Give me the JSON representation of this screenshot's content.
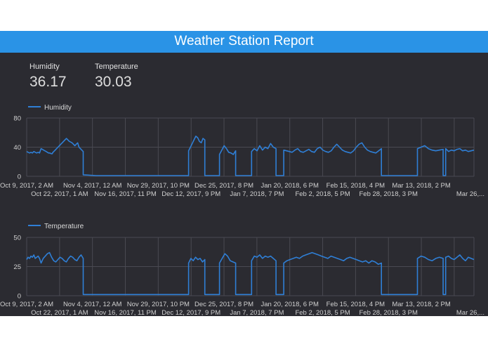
{
  "report": {
    "title": "Weather Station Report",
    "colors": {
      "header": "#2a93e6",
      "background": "#2b2b31",
      "series": "#2f7fd6",
      "grid": "#4a4a52"
    }
  },
  "scorecards": [
    {
      "label": "Humidity",
      "value": "36.17"
    },
    {
      "label": "Temperature",
      "value": "30.03"
    }
  ],
  "chart_data": [
    {
      "type": "line",
      "title": "",
      "series": [
        {
          "name": "Humidity"
        }
      ],
      "legend": "top-left",
      "ylim": [
        0,
        80
      ],
      "yticks": [
        "0",
        "40",
        "80"
      ],
      "grid": true,
      "xticks_row1": [
        "Oct 9, 2017, 2 AM",
        "Nov 4, 2017, 12 AM",
        "Nov 29, 2017, 10 PM",
        "Dec 25, 2017, 8 PM",
        "Jan 20, 2018, 6 PM",
        "Feb 15, 2018, 4 PM",
        "Mar 13, 2018, 2 PM"
      ],
      "xticks_row2": [
        "Oct 22, 2017, 1 AM",
        "Nov 16, 2017, 11 PM",
        "Dec 12, 2017, 9 PM",
        "Jan 7, 2018, 7 PM",
        "Feb 2, 2018, 5 PM",
        "Feb 28, 2018, 3 PM",
        "Mar 26,..."
      ],
      "segments": [
        {
          "x": [
            0.0,
            5.0
          ],
          "y": [
            34,
            33,
            32,
            33,
            32,
            34,
            33,
            32,
            33,
            32
          ]
        },
        {
          "x": [
            5.6,
            10.0
          ],
          "y": [
            38,
            37,
            36,
            35,
            34,
            33,
            32,
            32,
            31,
            31
          ]
        },
        {
          "x": [
            10.0,
            22.0
          ],
          "y": [
            32,
            34,
            36,
            38,
            40,
            42,
            44,
            46,
            48,
            50,
            52,
            50,
            48,
            47,
            46,
            44,
            42,
            44,
            46,
            40,
            38,
            36,
            34
          ]
        },
        {
          "x": [
            22.0,
            63.0
          ],
          "y": [
            2,
            1,
            1,
            1,
            1,
            1,
            1,
            1,
            1
          ]
        },
        {
          "x": [
            63.0,
            69.3
          ],
          "y": [
            35,
            40,
            45,
            50,
            55,
            53,
            48,
            46,
            52,
            50
          ]
        },
        {
          "x": [
            69.3,
            75.0
          ],
          "y": [
            1,
            1,
            1
          ]
        },
        {
          "x": [
            75.0,
            81.3
          ],
          "y": [
            30,
            36,
            42,
            38,
            33,
            32,
            30,
            35
          ]
        },
        {
          "x": [
            81.3,
            87.5
          ],
          "y": [
            1,
            1,
            1
          ]
        },
        {
          "x": [
            87.5,
            97.0
          ],
          "y": [
            34,
            38,
            35,
            42,
            36,
            40,
            38,
            45,
            40,
            38
          ]
        },
        {
          "x": [
            97.0,
            100.0
          ],
          "y": [
            1,
            1
          ]
        },
        {
          "x": [
            100.0,
            138.0
          ],
          "y": [
            36,
            35,
            34,
            33,
            36,
            38,
            34,
            33,
            35,
            37,
            34,
            33,
            38,
            40,
            36,
            34,
            33,
            35,
            40,
            44,
            40,
            36,
            34,
            33,
            32,
            35,
            40,
            44,
            46,
            40,
            36,
            34,
            33,
            32,
            35,
            38
          ]
        },
        {
          "x": [
            138.0,
            152.0
          ],
          "y": [
            1,
            1,
            1,
            1
          ]
        },
        {
          "x": [
            152.0,
            162.0
          ],
          "y": [
            38,
            40,
            42,
            38,
            36,
            35,
            36,
            37
          ]
        },
        {
          "x": [
            162.0,
            163.0
          ],
          "y": [
            1,
            1
          ]
        },
        {
          "x": [
            163.0,
            174.0
          ],
          "y": [
            38,
            34,
            36,
            35,
            37,
            38,
            35,
            36,
            34,
            35,
            36
          ]
        }
      ]
    },
    {
      "type": "line",
      "title": "",
      "series": [
        {
          "name": "Temperature"
        }
      ],
      "legend": "top-left",
      "ylim": [
        0,
        50
      ],
      "yticks": [
        "0",
        "25",
        "50"
      ],
      "grid": true,
      "xticks_row1": [
        "Oct 9, 2017, 2 AM",
        "Nov 4, 2017, 12 AM",
        "Nov 29, 2017, 10 PM",
        "Dec 25, 2017, 8 PM",
        "Jan 20, 2018, 6 PM",
        "Feb 15, 2018, 4 PM",
        "Mar 13, 2018, 2 PM"
      ],
      "xticks_row2": [
        "Oct 22, 2017, 1 AM",
        "Nov 16, 2017, 11 PM",
        "Dec 12, 2017, 9 PM",
        "Jan 7, 2018, 7 PM",
        "Feb 2, 2018, 5 PM",
        "Feb 28, 2018, 3 PM",
        "Mar 26,..."
      ],
      "segments": [
        {
          "x": [
            0.0,
            5.0
          ],
          "y": [
            31,
            33,
            32,
            34,
            33,
            35,
            32,
            33,
            34,
            32
          ]
        },
        {
          "x": [
            5.6,
            22.0
          ],
          "y": [
            28,
            32,
            34,
            36,
            37,
            33,
            30,
            29,
            31,
            33,
            32,
            30,
            29,
            32,
            34,
            33,
            31,
            30,
            33,
            35,
            32
          ]
        },
        {
          "x": [
            22.0,
            63.0
          ],
          "y": [
            1,
            1,
            1,
            1,
            1,
            1,
            1,
            1,
            1
          ]
        },
        {
          "x": [
            63.0,
            69.3
          ],
          "y": [
            28,
            32,
            30,
            33,
            31,
            32,
            29,
            31
          ]
        },
        {
          "x": [
            69.3,
            75.0
          ],
          "y": [
            1,
            1,
            1
          ]
        },
        {
          "x": [
            75.0,
            81.3
          ],
          "y": [
            28,
            32,
            36,
            34,
            30,
            29,
            28
          ]
        },
        {
          "x": [
            81.3,
            87.5
          ],
          "y": [
            1,
            1,
            1
          ]
        },
        {
          "x": [
            87.5,
            97.0
          ],
          "y": [
            30,
            34,
            33,
            35,
            32,
            34,
            33,
            34,
            32,
            30
          ]
        },
        {
          "x": [
            97.0,
            100.0
          ],
          "y": [
            1,
            1
          ]
        },
        {
          "x": [
            100.0,
            138.0
          ],
          "y": [
            28,
            30,
            31,
            32,
            33,
            32,
            34,
            35,
            36,
            37,
            36,
            35,
            34,
            33,
            32,
            34,
            33,
            32,
            31,
            30,
            32,
            33,
            32,
            31,
            30,
            29,
            30,
            28,
            30,
            29,
            27,
            28
          ]
        },
        {
          "x": [
            138.0,
            152.0
          ],
          "y": [
            1,
            1,
            1,
            1
          ]
        },
        {
          "x": [
            152.0,
            162.0
          ],
          "y": [
            32,
            34,
            33,
            31,
            30,
            32,
            33,
            32
          ]
        },
        {
          "x": [
            162.0,
            163.0
          ],
          "y": [
            1,
            1
          ]
        },
        {
          "x": [
            163.0,
            174.0
          ],
          "y": [
            33,
            34,
            32,
            31,
            33,
            35,
            32,
            30,
            33,
            32,
            31
          ]
        }
      ]
    }
  ]
}
